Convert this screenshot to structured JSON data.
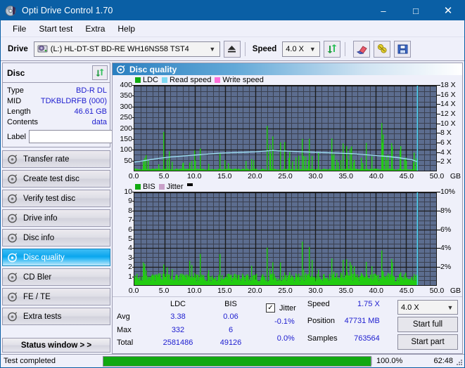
{
  "window": {
    "title": "Opti Drive Control 1.70",
    "minimize": "–",
    "maximize": "□",
    "close": "✕"
  },
  "menu": [
    "File",
    "Start test",
    "Extra",
    "Help"
  ],
  "toolbar": {
    "drive_label": "Drive",
    "drive_value": "(L:)  HL-DT-ST BD-RE  WH16NS58 TST4",
    "eject_icon": "eject-icon",
    "speed_label": "Speed",
    "speed_value": "4.0 X",
    "refresh_icon": "refresh-icon",
    "erase_icon": "eraser-icon",
    "bookmark_icon": "bookmark-icon",
    "save_icon": "save-icon"
  },
  "disc": {
    "heading": "Disc",
    "refresh_icon": "refresh-icon",
    "rows": [
      {
        "key": "Type",
        "value": "BD-R DL"
      },
      {
        "key": "MID",
        "value": "TDKBLDRFB (000)"
      },
      {
        "key": "Length",
        "value": "46.61 GB"
      },
      {
        "key": "Contents",
        "value": "data"
      }
    ],
    "label_key": "Label",
    "label_value": "",
    "label_placeholder": "",
    "disc_icon": "disc-icon"
  },
  "sidebar": {
    "items": [
      {
        "label": "Transfer rate",
        "icon": "disc-icon",
        "active": false
      },
      {
        "label": "Create test disc",
        "icon": "disc-icon",
        "active": false
      },
      {
        "label": "Verify test disc",
        "icon": "disc-icon",
        "active": false
      },
      {
        "label": "Drive info",
        "icon": "disc-icon",
        "active": false
      },
      {
        "label": "Disc info",
        "icon": "disc-icon",
        "active": false
      },
      {
        "label": "Disc quality",
        "icon": "disc-icon",
        "active": true
      },
      {
        "label": "CD Bler",
        "icon": "disc-icon",
        "active": false
      },
      {
        "label": "FE / TE",
        "icon": "disc-icon",
        "active": false
      },
      {
        "label": "Extra tests",
        "icon": "disc-icon",
        "active": false
      }
    ],
    "status_window_button": "Status window > >"
  },
  "content": {
    "heading": "Disc quality",
    "heading_icon": "disc-icon"
  },
  "stats": {
    "row_labels": [
      "Avg",
      "Max",
      "Total"
    ],
    "columns": [
      "LDC",
      "BIS"
    ],
    "ldc": {
      "avg": "3.38",
      "max": "332",
      "total": "2581486"
    },
    "bis": {
      "avg": "0.06",
      "max": "6",
      "total": "49126"
    },
    "jitter": {
      "label": "Jitter",
      "checked": true,
      "check_glyph": "✓",
      "avg": "-0.1%",
      "max": "0.0%"
    },
    "speed_label": "Speed",
    "speed_value": "1.75 X",
    "position_label": "Position",
    "position_value": "47731 MB",
    "samples_label": "Samples",
    "samples_value": "763564",
    "speed_select": "4.0 X",
    "start_full": "Start full",
    "start_part": "Start part"
  },
  "statusbar": {
    "text": "Test completed",
    "progress_percent": 100,
    "percent_label": "100.0%",
    "time": "62:48"
  },
  "colors": {
    "accent": "#0a5fa5",
    "plot_bg": "#5c6d8f",
    "grid": "#262626",
    "ldc_green": "#22cc11",
    "read_speed": "#7fd9f2",
    "write_speed": "#ff6fd8",
    "jitter": "#c8a0c8",
    "value_blue": "#2020d0",
    "progress_green": "#11a811",
    "cyan_marker": "#4fd8f8"
  },
  "chart_data": [
    {
      "type": "line",
      "id": "top-chart",
      "title": "Disc quality",
      "legend": [
        {
          "name": "LDC",
          "color": "#11aa11"
        },
        {
          "name": "Read speed",
          "color": "#7fd9f2"
        },
        {
          "name": "Write speed",
          "color": "#ff6fd8"
        }
      ],
      "legend_position": "top-left",
      "grid": true,
      "xlabel": "GB",
      "xlim": [
        0,
        50
      ],
      "xticks": [
        "0.0",
        "5.0",
        "10.0",
        "15.0",
        "20.0",
        "25.0",
        "30.0",
        "35.0",
        "40.0",
        "45.0",
        "50.0"
      ],
      "ylabel": "LDC",
      "ylim": [
        0,
        400
      ],
      "yticks": [
        50,
        100,
        150,
        200,
        250,
        300,
        350,
        400
      ],
      "y2label": "Speed",
      "y2lim": [
        0,
        18
      ],
      "y2ticks": [
        "2 X",
        "4 X",
        "6 X",
        "8 X",
        "10 X",
        "12 X",
        "14 X",
        "16 X",
        "18 X"
      ],
      "scan_end_gb": 46.9,
      "series": [
        {
          "name": "LDC",
          "type": "impulse",
          "color": "#22cc11",
          "x": [
            0.2,
            0.6,
            1.0,
            1.5,
            2.0,
            2.4,
            2.6,
            3.0,
            3.4,
            3.8,
            4.2,
            4.6,
            5.0,
            5.4,
            5.8,
            6.2,
            6.6,
            7.0,
            7.4,
            7.8,
            8.2,
            8.6,
            9.0,
            9.4,
            9.8,
            10.2,
            10.6,
            11.0,
            11.4,
            11.8,
            12.2,
            12.6,
            13.0,
            13.4,
            13.8,
            14.2,
            14.6,
            15.0,
            15.4,
            15.8,
            16.2,
            16.6,
            17.0,
            17.4,
            17.8,
            18.2,
            18.6,
            19.0,
            19.4,
            19.8,
            20.2,
            20.6,
            21.0,
            21.4,
            21.8,
            22.2,
            22.6,
            23.0,
            23.2,
            23.4,
            23.6,
            23.8,
            24.0,
            24.4,
            24.8,
            25.2,
            25.6,
            26.0,
            26.4,
            26.8,
            27.2,
            27.6,
            28.0,
            28.4,
            28.8,
            29.2,
            29.6,
            30.0,
            30.4,
            30.8,
            31.2,
            31.6,
            32.0,
            32.4,
            32.8,
            33.2,
            33.6,
            34.0,
            34.4,
            34.8,
            35.2,
            35.6,
            36.0,
            36.4,
            36.8,
            37.2,
            37.6,
            38.0,
            38.4,
            38.8,
            39.2,
            39.6,
            40.0,
            40.4,
            40.8,
            41.2,
            41.6,
            42.0,
            42.4,
            42.8,
            43.2,
            43.6,
            44.0,
            44.4,
            44.8,
            45.2,
            45.6,
            46.0,
            46.4,
            46.8
          ],
          "y": [
            30,
            45,
            60,
            40,
            220,
            55,
            50,
            70,
            45,
            90,
            60,
            265,
            70,
            55,
            185,
            60,
            75,
            50,
            95,
            60,
            70,
            160,
            55,
            80,
            175,
            65,
            60,
            120,
            70,
            90,
            55,
            75,
            145,
            60,
            110,
            70,
            85,
            130,
            60,
            95,
            75,
            140,
            65,
            100,
            80,
            120,
            70,
            160,
            90,
            110,
            130,
            150,
            175,
            210,
            255,
            190,
            230,
            165,
            200,
            145,
            185,
            160,
            175,
            140,
            205,
            130,
            150,
            120,
            135,
            100,
            160,
            115,
            140,
            95,
            130,
            110,
            125,
            90,
            145,
            105,
            135,
            100,
            120,
            85,
            150,
            95,
            115,
            80,
            130,
            100,
            110,
            90,
            125,
            75,
            105,
            95,
            115,
            80,
            130,
            90,
            110,
            75,
            125,
            85,
            170,
            330,
            120,
            155,
            100,
            140,
            90,
            120,
            225,
            100,
            85,
            130,
            70,
            95,
            60,
            45
          ]
        },
        {
          "name": "Read speed",
          "type": "line",
          "color": "#9fe2f5",
          "x": [
            0,
            2,
            4,
            6,
            8,
            10,
            12,
            14,
            16,
            18,
            20,
            22,
            23,
            24,
            26,
            28,
            30,
            32,
            34,
            36,
            38,
            40,
            42,
            44,
            46,
            46.9
          ],
          "y": [
            1.8,
            2.2,
            2.6,
            2.9,
            3.1,
            3.3,
            3.5,
            3.7,
            3.8,
            3.9,
            4.0,
            4.2,
            4.3,
            4.2,
            4.1,
            4.0,
            3.9,
            3.8,
            3.7,
            3.6,
            3.4,
            3.2,
            3.0,
            2.7,
            2.3,
            1.9
          ],
          "unit": "X"
        }
      ]
    },
    {
      "type": "line",
      "id": "bottom-chart",
      "legend": [
        {
          "name": "BIS",
          "color": "#11aa11"
        },
        {
          "name": "Jitter",
          "color": "#c8a0c8"
        }
      ],
      "legend_position": "top-left",
      "grid": true,
      "xlabel": "GB",
      "xlim": [
        0,
        50
      ],
      "xticks": [
        "0.0",
        "5.0",
        "10.0",
        "15.0",
        "20.0",
        "25.0",
        "30.0",
        "35.0",
        "40.0",
        "45.0",
        "50.0"
      ],
      "ylabel": "BIS",
      "ylim": [
        0,
        10
      ],
      "yticks": [
        1,
        2,
        3,
        4,
        5,
        6,
        7,
        8,
        9,
        10
      ],
      "y2label": "Jitter",
      "y2lim": [
        0,
        10
      ],
      "y2ticks": [
        "2%",
        "4%",
        "6%",
        "8%",
        "10%"
      ],
      "scan_end_gb": 46.9,
      "series": [
        {
          "name": "BIS",
          "type": "impulse",
          "color": "#22cc11",
          "x": [
            0.3,
            0.8,
            1.3,
            1.8,
            2.3,
            2.8,
            3.3,
            3.8,
            4.3,
            4.8,
            5.3,
            5.8,
            6.3,
            6.8,
            7.3,
            7.8,
            8.3,
            8.8,
            9.3,
            9.8,
            10.3,
            10.8,
            11.3,
            11.8,
            12.3,
            12.8,
            13.3,
            13.8,
            14.3,
            14.8,
            15.3,
            15.8,
            16.3,
            16.8,
            17.3,
            17.8,
            18.3,
            18.8,
            19.3,
            19.8,
            20.3,
            20.8,
            21.3,
            21.8,
            22.3,
            22.8,
            23.3,
            23.8,
            24.3,
            24.8,
            25.3,
            25.8,
            26.3,
            26.8,
            27.3,
            27.8,
            28.3,
            28.8,
            29.3,
            29.8,
            30.3,
            30.8,
            31.3,
            31.8,
            32.3,
            32.8,
            33.3,
            33.8,
            34.3,
            34.8,
            35.3,
            35.8,
            36.3,
            36.8,
            37.3,
            37.8,
            38.3,
            38.8,
            39.3,
            39.8,
            40.3,
            40.8,
            41.3,
            41.8,
            42.3,
            42.8,
            43.3,
            43.8,
            44.3,
            44.8,
            45.3,
            45.8,
            46.3,
            46.8
          ],
          "y": [
            2,
            2,
            2,
            4,
            2,
            2,
            6,
            2,
            6,
            2,
            2,
            2,
            3,
            2,
            4,
            2,
            2,
            3,
            5,
            2,
            2,
            3,
            4,
            2,
            3,
            2,
            3,
            2,
            4,
            2,
            2,
            3,
            2,
            2,
            3,
            2,
            2,
            3,
            4,
            2,
            3,
            2,
            6,
            5,
            3,
            3,
            2,
            3,
            3,
            2,
            3,
            2,
            3,
            2,
            3,
            4,
            2,
            3,
            5,
            2,
            3,
            2,
            4,
            2,
            3,
            2,
            3,
            2,
            3,
            2,
            3,
            2,
            3,
            4,
            2,
            3,
            2,
            6,
            3,
            2,
            3,
            4,
            2,
            3,
            2,
            3,
            2,
            3,
            2,
            2,
            2,
            1,
            1,
            1
          ]
        }
      ]
    }
  ]
}
